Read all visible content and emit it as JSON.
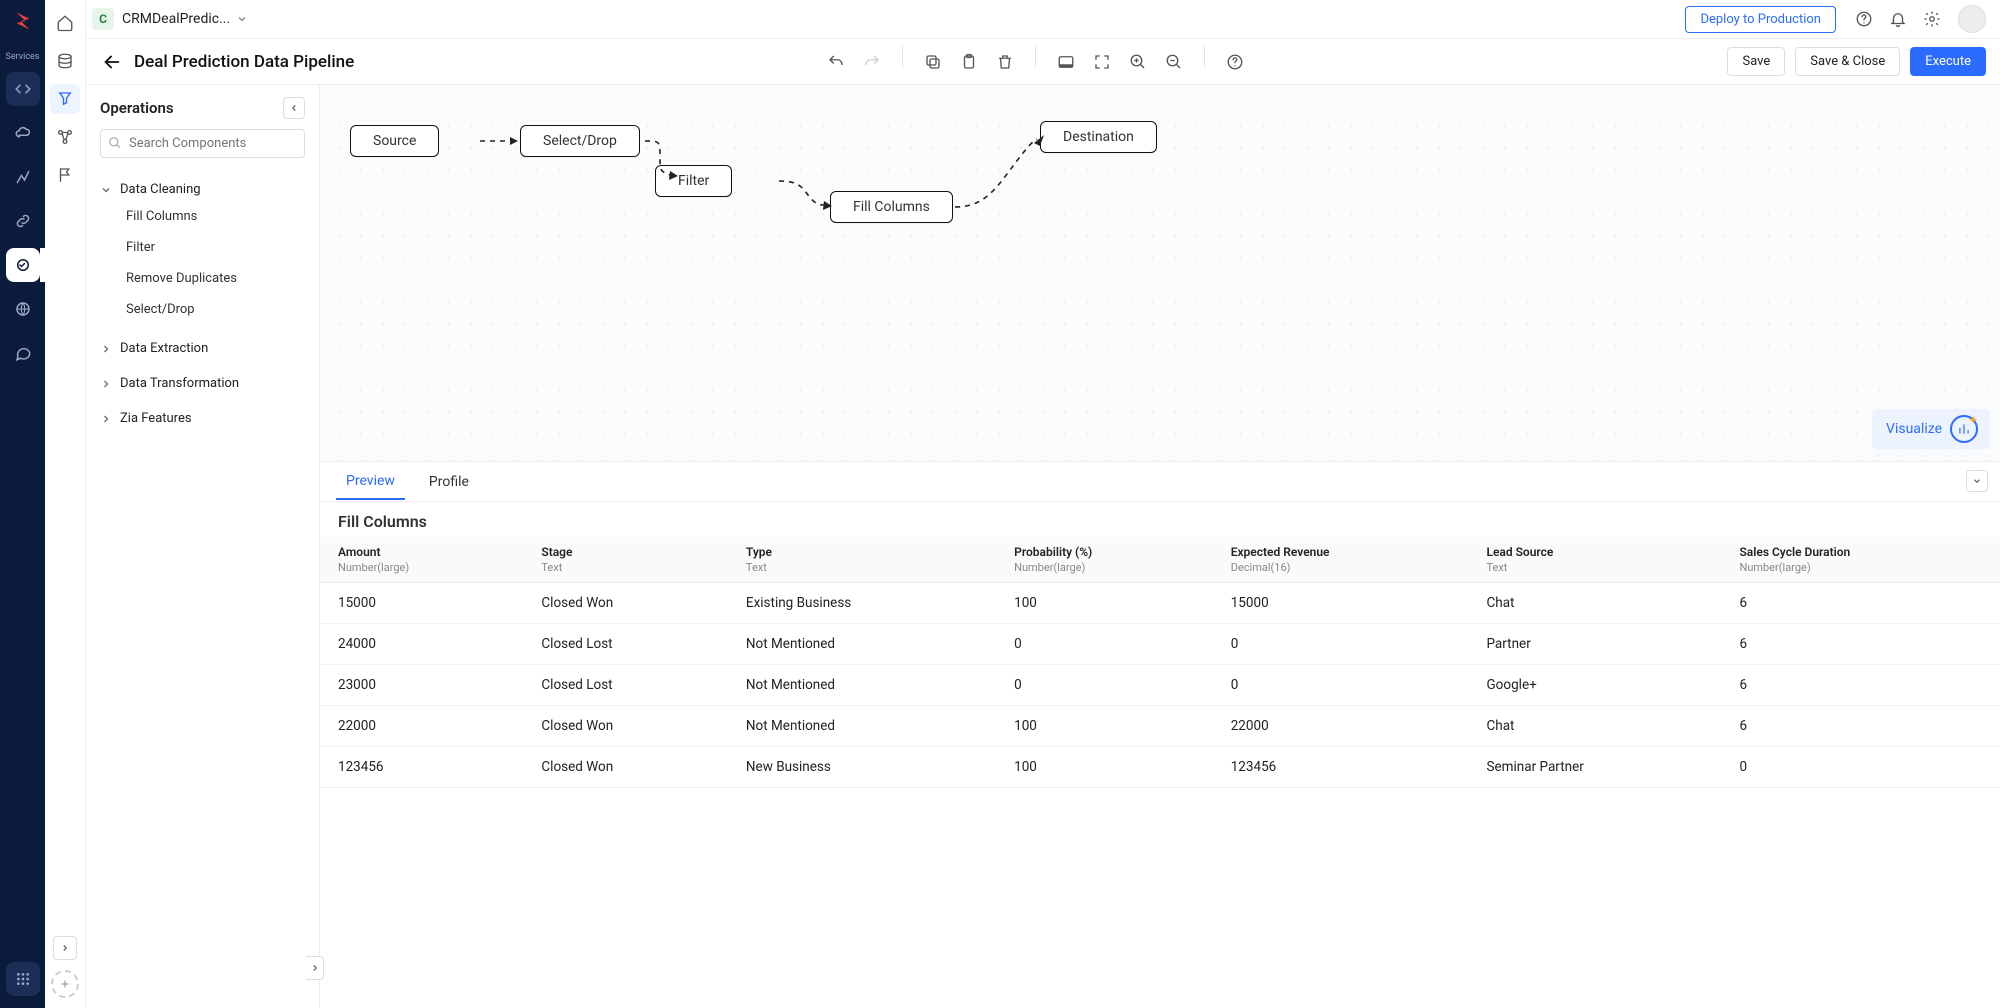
{
  "project": {
    "badge": "C",
    "name": "CRMDealPredic..."
  },
  "topbar": {
    "deploy": "Deploy to Production"
  },
  "services_label": "Services",
  "toolbar": {
    "title": "Deal Prediction Data Pipeline",
    "save": "Save",
    "save_close": "Save & Close",
    "execute": "Execute"
  },
  "ops": {
    "header": "Operations",
    "search_placeholder": "Search Components",
    "groups": [
      {
        "label": "Data Cleaning",
        "expanded": true,
        "items": [
          "Fill Columns",
          "Filter",
          "Remove Duplicates",
          "Select/Drop"
        ]
      },
      {
        "label": "Data Extraction",
        "expanded": false,
        "items": []
      },
      {
        "label": "Data Transformation",
        "expanded": false,
        "items": []
      },
      {
        "label": "Zia Features",
        "expanded": false,
        "items": []
      }
    ]
  },
  "canvas": {
    "nodes": {
      "source": "Source",
      "select_drop": "Select/Drop",
      "filter": "Filter",
      "fill_columns": "Fill Columns",
      "destination": "Destination"
    },
    "visualize": "Visualize"
  },
  "preview": {
    "tabs": {
      "preview": "Preview",
      "profile": "Profile"
    },
    "section_title": "Fill Columns",
    "columns": [
      {
        "name": "Amount",
        "type": "Number(large)"
      },
      {
        "name": "Stage",
        "type": "Text"
      },
      {
        "name": "Type",
        "type": "Text"
      },
      {
        "name": "Probability (%)",
        "type": "Number(large)"
      },
      {
        "name": "Expected Revenue",
        "type": "Decimal(16)"
      },
      {
        "name": "Lead Source",
        "type": "Text"
      },
      {
        "name": "Sales Cycle Duration",
        "type": "Number(large)"
      }
    ],
    "rows": [
      [
        "15000",
        "Closed Won",
        "Existing Business",
        "100",
        "15000",
        "Chat",
        "6"
      ],
      [
        "24000",
        "Closed Lost",
        "Not Mentioned",
        "0",
        "0",
        "Partner",
        "6"
      ],
      [
        "23000",
        "Closed Lost",
        "Not Mentioned",
        "0",
        "0",
        "Google+",
        "6"
      ],
      [
        "22000",
        "Closed Won",
        "Not Mentioned",
        "100",
        "22000",
        "Chat",
        "6"
      ],
      [
        "123456",
        "Closed Won",
        "New Business",
        "100",
        "123456",
        "Seminar Partner",
        "0"
      ]
    ]
  }
}
